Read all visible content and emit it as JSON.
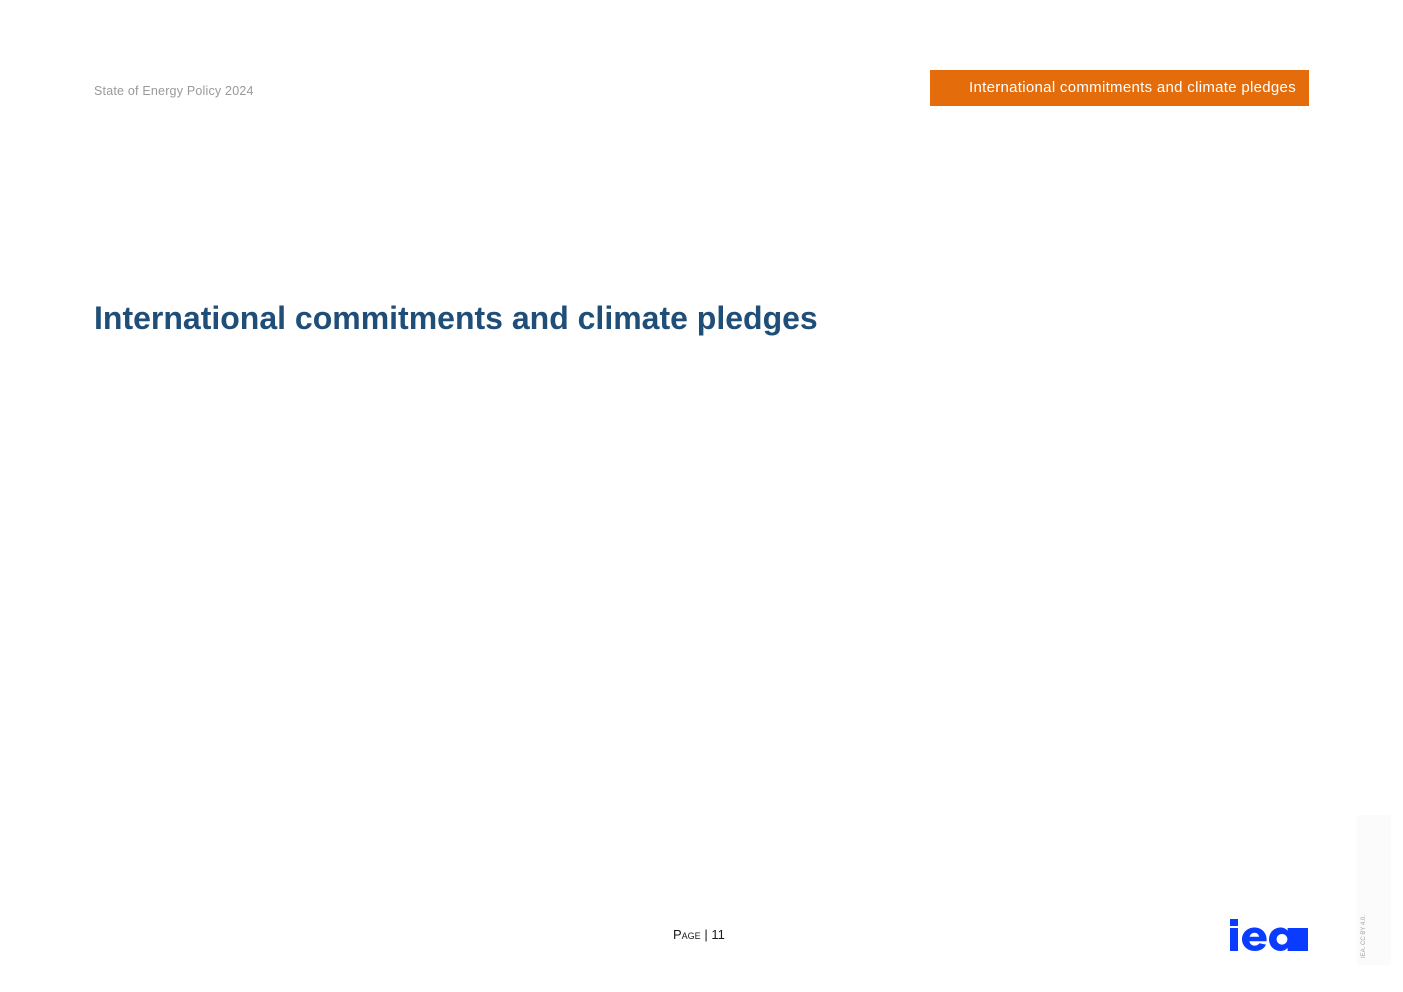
{
  "header": {
    "publication": "State of Energy Policy 2024",
    "section_tab": "International commitments and climate pledges"
  },
  "main": {
    "chapter_title": "International commitments and climate pledges"
  },
  "footer": {
    "page_label": "Page",
    "page_separator": "|",
    "page_number": "11",
    "logo_text": "iea",
    "license": "IEA. CC BY 4.0."
  },
  "colors": {
    "accent_orange": "#e46c0a",
    "title_blue": "#1f4e79",
    "logo_blue": "#0a3cff"
  }
}
